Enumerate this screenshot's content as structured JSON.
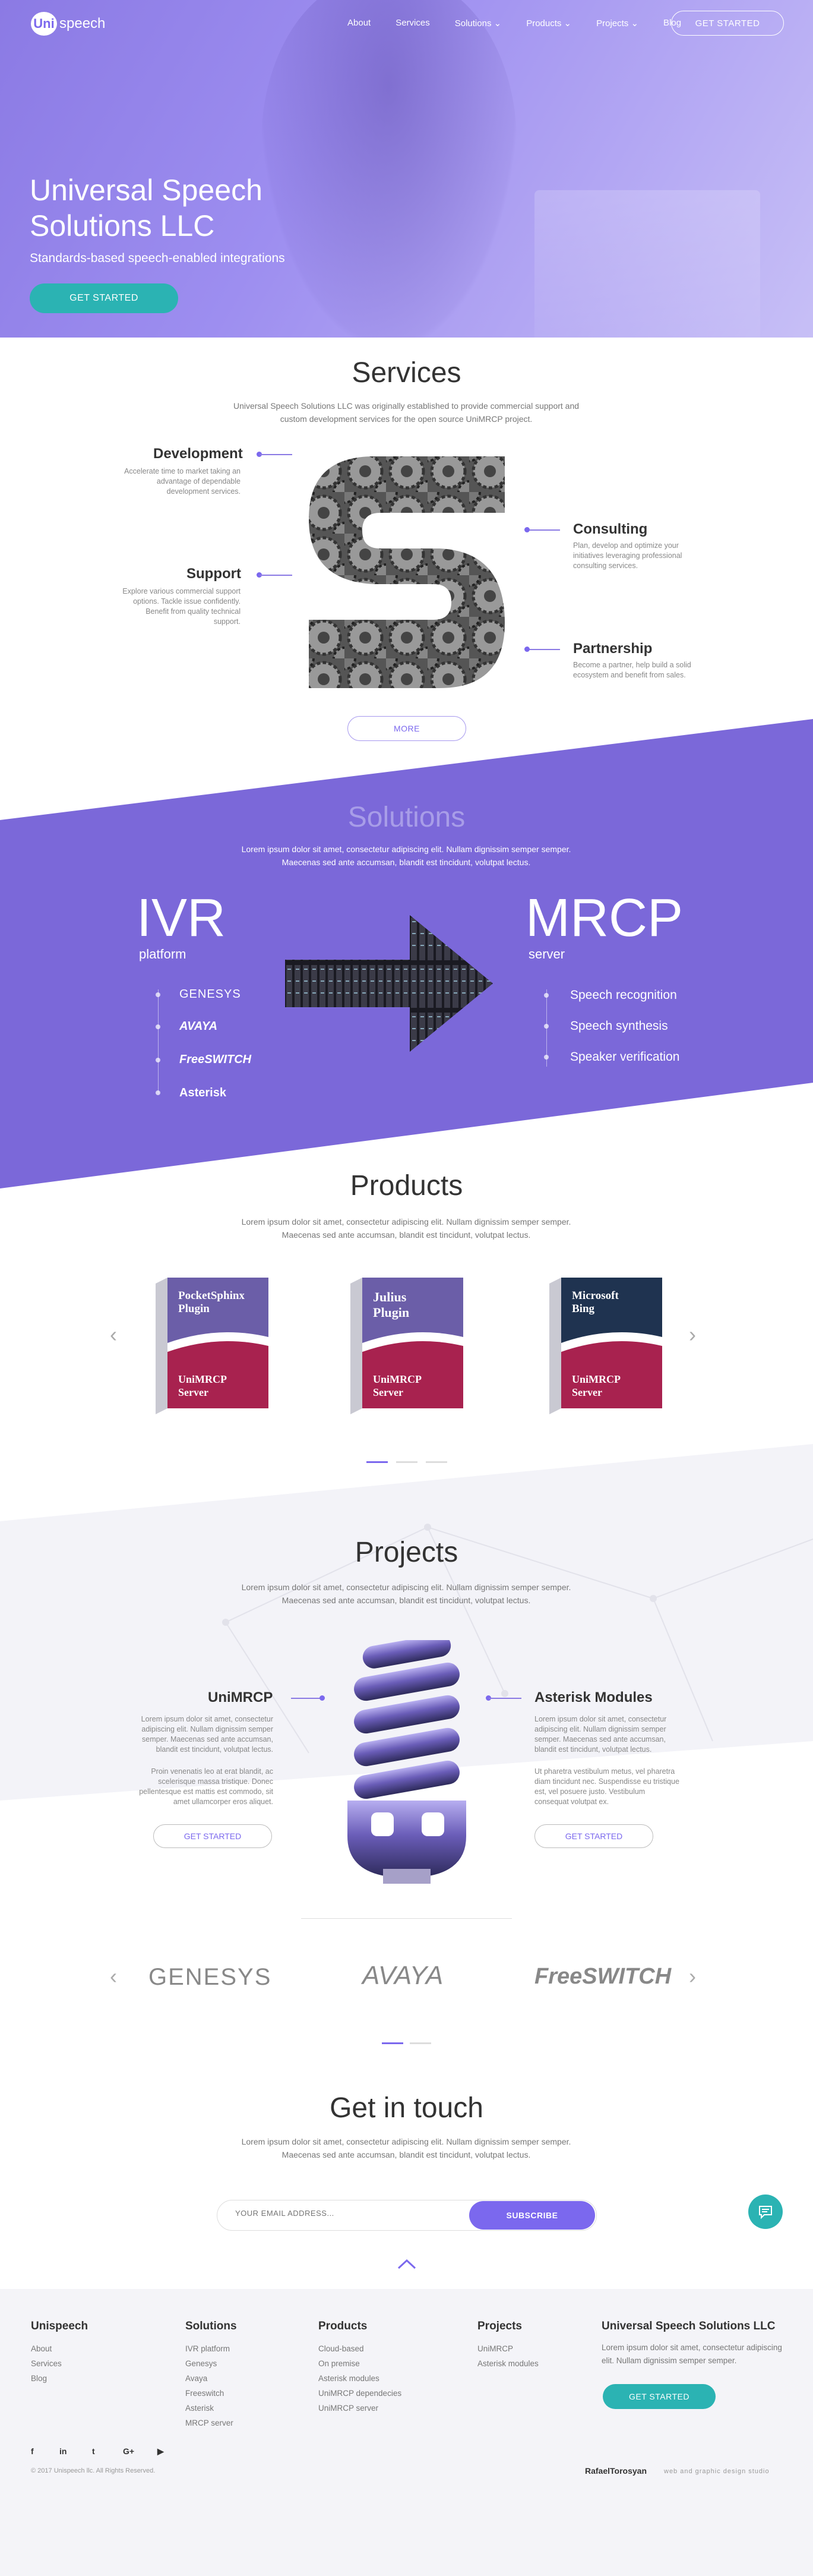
{
  "header": {
    "logo_badge": "Uni",
    "logo_rest": "speech",
    "nav": [
      "About",
      "Services",
      "Solutions ⌄",
      "Products ⌄",
      "Projects ⌄",
      "Blog"
    ],
    "cta": "GET STARTED"
  },
  "hero": {
    "title": "Universal Speech Solutions LLC",
    "subtitle": "Standards-based speech-enabled integrations",
    "cta": "GET STARTED"
  },
  "services": {
    "title": "Services",
    "lede": "Universal Speech Solutions LLC was originally established to provide commercial support and custom development services for the open source UniMRCP project.",
    "items": [
      {
        "title": "Development",
        "text": "Accelerate time to market taking an advantage of dependable development services."
      },
      {
        "title": "Support",
        "text": "Explore various commercial support options. Tackle issue confidently. Benefit from quality technical support."
      },
      {
        "title": "Consulting",
        "text": "Plan, develop and optimize your initiatives leveraging professional consulting services."
      },
      {
        "title": "Partnership",
        "text": "Become a partner, help build a solid ecosystem and benefit from sales."
      }
    ],
    "more": "MORE"
  },
  "solutions": {
    "title": "Solutions",
    "lede": "Lorem ipsum dolor sit amet, consectetur adipiscing elit. Nullam dignissim semper semper. Maecenas sed ante accumsan, blandit est tincidunt, volutpat lectus.",
    "left_big": "IVR",
    "left_small": "platform",
    "brands": [
      "GENESYS",
      "AVAYA",
      "FreeSWITCH",
      "Asterisk"
    ],
    "right_big": "MRCP",
    "right_small": "server",
    "features": [
      "Speech recognition",
      "Speech synthesis",
      "Speaker verification"
    ]
  },
  "products": {
    "title": "Products",
    "lede": "Lorem ipsum dolor sit amet, consectetur adipiscing elit. Nullam dignissim semper semper. Maecenas sed ante accumsan, blandit est tincidunt, volutpat lectus.",
    "boxes": [
      {
        "name": "PocketSphinx Plugin",
        "server": "UniMRCP Server",
        "top": "#6b5ea8"
      },
      {
        "name": "Julius Plugin",
        "server": "UniMRCP Server",
        "top": "#6b5ea8"
      },
      {
        "name": "Microsoft Bing",
        "server": "UniMRCP Server",
        "top": "#1f3350"
      }
    ],
    "prev": "‹",
    "next": "›"
  },
  "projects": {
    "title": "Projects",
    "lede": "Lorem ipsum dolor sit amet, consectetur adipiscing elit. Nullam dignissim semper semper. Maecenas sed ante accumsan, blandit est tincidunt, volutpat lectus.",
    "left": {
      "title": "UniMRCP",
      "p1": "Lorem ipsum dolor sit amet, consectetur adipiscing elit. Nullam dignissim semper semper. Maecenas sed ante accumsan, blandit est tincidunt, volutpat lectus.",
      "p2": "Proin venenatis leo at erat blandit, ac scelerisque massa tristique. Donec pellentesque est mattis est commodo, sit amet ullamcorper eros aliquet.",
      "cta": "GET STARTED"
    },
    "right": {
      "title": "Asterisk Modules",
      "p1": "Lorem ipsum dolor sit amet, consectetur adipiscing elit. Nullam dignissim semper semper. Maecenas sed ante accumsan, blandit est tincidunt, volutpat lectus.",
      "p2": "Ut pharetra vestibulum metus, vel pharetra diam tincidunt nec. Suspendisse eu tristique est, vel posuere justo. Vestibulum consequat volutpat ex.",
      "cta": "GET STARTED"
    }
  },
  "partners": {
    "logos": [
      "GENESYS",
      "AVAYA",
      "FreeSWITCH"
    ],
    "prev": "‹",
    "next": "›"
  },
  "contact": {
    "title": "Get in touch",
    "lede": "Lorem ipsum dolor sit amet, consectetur adipiscing elit. Nullam dignissim semper semper. Maecenas sed ante accumsan, blandit est tincidunt, volutpat lectus.",
    "email_placeholder": "YOUR EMAIL ADDRESS...",
    "subscribe": "SUBSCRIBE"
  },
  "footer": {
    "col1": {
      "title": "Unispeech",
      "links": [
        "About",
        "Services",
        "Blog"
      ]
    },
    "col2": {
      "title": "Solutions",
      "links": [
        "IVR platform",
        "Genesys",
        "Avaya",
        "Freeswitch",
        "Asterisk",
        "MRCP server"
      ]
    },
    "col3": {
      "title": "Products",
      "links": [
        "Cloud-based",
        "On premise",
        "Asterisk modules",
        "UniMRCP dependecies",
        "UniMRCP server"
      ]
    },
    "col4": {
      "title": "Projects",
      "links": [
        "UniMRCP",
        "Asterisk modules"
      ]
    },
    "col5": {
      "title": "Universal Speech Solutions LLC",
      "text": "Lorem ipsum dolor sit amet, consectetur adipiscing elit. Nullam dignissim semper semper.",
      "cta": "GET STARTED"
    },
    "social": [
      "f",
      "in",
      "t",
      "G+",
      "▶"
    ],
    "copyright": "© 2017 Unispeech llc. All Rights Reserved.",
    "credit": "RafaelTorosyan",
    "credit_sub": "web and graphic design studio"
  },
  "colors": {
    "accent": "#7b68ee",
    "teal": "#2bb3b3"
  }
}
